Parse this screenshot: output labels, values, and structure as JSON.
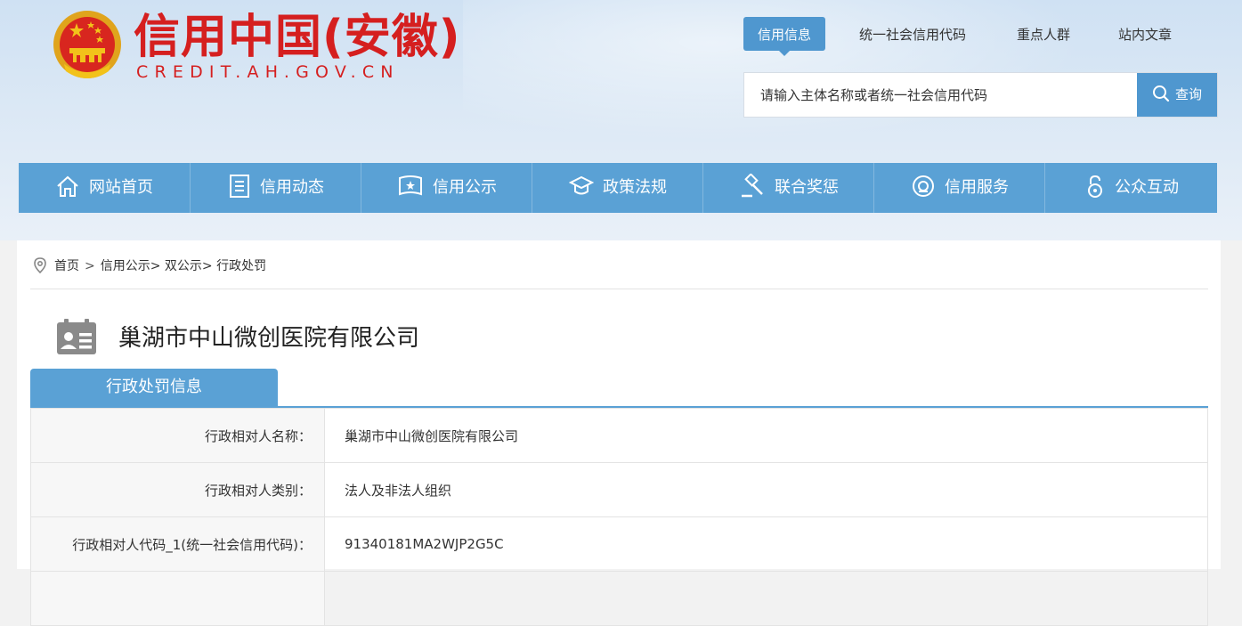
{
  "site": {
    "title": "信用中国(安徽)",
    "domain": "CREDIT.AH.GOV.CN"
  },
  "topnav": [
    {
      "label": "信用信息",
      "active": true
    },
    {
      "label": "统一社会信用代码",
      "active": false
    },
    {
      "label": "重点人群",
      "active": false
    },
    {
      "label": "站内文章",
      "active": false
    }
  ],
  "search": {
    "placeholder": "请输入主体名称或者统一社会信用代码",
    "button_label": "查询",
    "icon": "search-icon"
  },
  "mainnav": [
    {
      "label": "网站首页",
      "icon": "home-icon"
    },
    {
      "label": "信用动态",
      "icon": "document-list-icon"
    },
    {
      "label": "信用公示",
      "icon": "bulletin-book-icon"
    },
    {
      "label": "政策法规",
      "icon": "graduation-cap-icon"
    },
    {
      "label": "联合奖惩",
      "icon": "gavel-icon"
    },
    {
      "label": "信用服务",
      "icon": "service-badge-icon"
    },
    {
      "label": "公众互动",
      "icon": "lock-person-icon"
    }
  ],
  "breadcrumb": {
    "icon": "location-pin-icon",
    "items": [
      "首页",
      "信用公示>",
      "双公示>",
      "行政处罚"
    ],
    "separator": ">"
  },
  "entity": {
    "name": "巢湖市中山微创医院有限公司",
    "icon": "business-card-icon"
  },
  "tab": {
    "label": "行政处罚信息"
  },
  "info_rows": [
    {
      "key": "行政相对人名称：",
      "value": "巢湖市中山微创医院有限公司"
    },
    {
      "key": "行政相对人类别：",
      "value": "法人及非法人组织"
    },
    {
      "key": "行政相对人代码_1(统一社会信用代码)：",
      "value": "91340181MA2WJP2G5C"
    },
    {
      "key": "",
      "value": ""
    }
  ],
  "colors": {
    "brand_red": "#d51f1f",
    "nav_blue": "#5aa1d5",
    "accent_blue": "#4f97cf"
  }
}
